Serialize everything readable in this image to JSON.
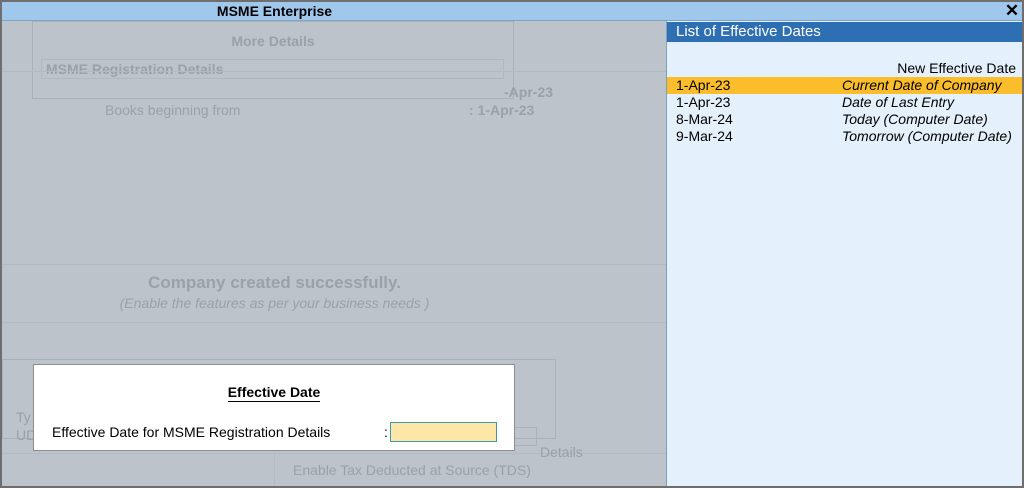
{
  "window": {
    "title": "MSME Enterprise",
    "close_symbol": "✕"
  },
  "background": {
    "more_details_title": "More Details",
    "registration_row": "MSME Registration Details",
    "partial_date": "-Apr-23",
    "books_label": "Books beginning from",
    "books_value": ": 1-Apr-23",
    "company_created": "Company created successfully.",
    "company_sub": "(Enable the features as per your business needs )",
    "partial_typ": "Ty",
    "partial_ud": "UD",
    "partial_details": "Details",
    "partial_tds": "Enable Tax Deducted at Source (TDS)"
  },
  "dialog": {
    "title": "Effective Date",
    "label": "Effective Date for MSME Registration Details",
    "colon": ":",
    "input_value": ""
  },
  "panel": {
    "title": "List of Effective Dates",
    "column_header": "New Effective Date",
    "items": [
      {
        "date": "1-Apr-23",
        "desc": "Current Date of Company",
        "selected": true
      },
      {
        "date": "1-Apr-23",
        "desc": "Date of Last Entry",
        "selected": false
      },
      {
        "date": "8-Mar-24",
        "desc": "Today (Computer Date)",
        "selected": false
      },
      {
        "date": "9-Mar-24",
        "desc": "Tomorrow (Computer Date)",
        "selected": false
      }
    ]
  },
  "colors": {
    "titlebar": "#9fc8ec",
    "panel_header": "#2e6fb4",
    "panel_bg": "#e4f0fb",
    "selected_row": "#fbbd2b",
    "input_bg": "#fde7a8"
  }
}
